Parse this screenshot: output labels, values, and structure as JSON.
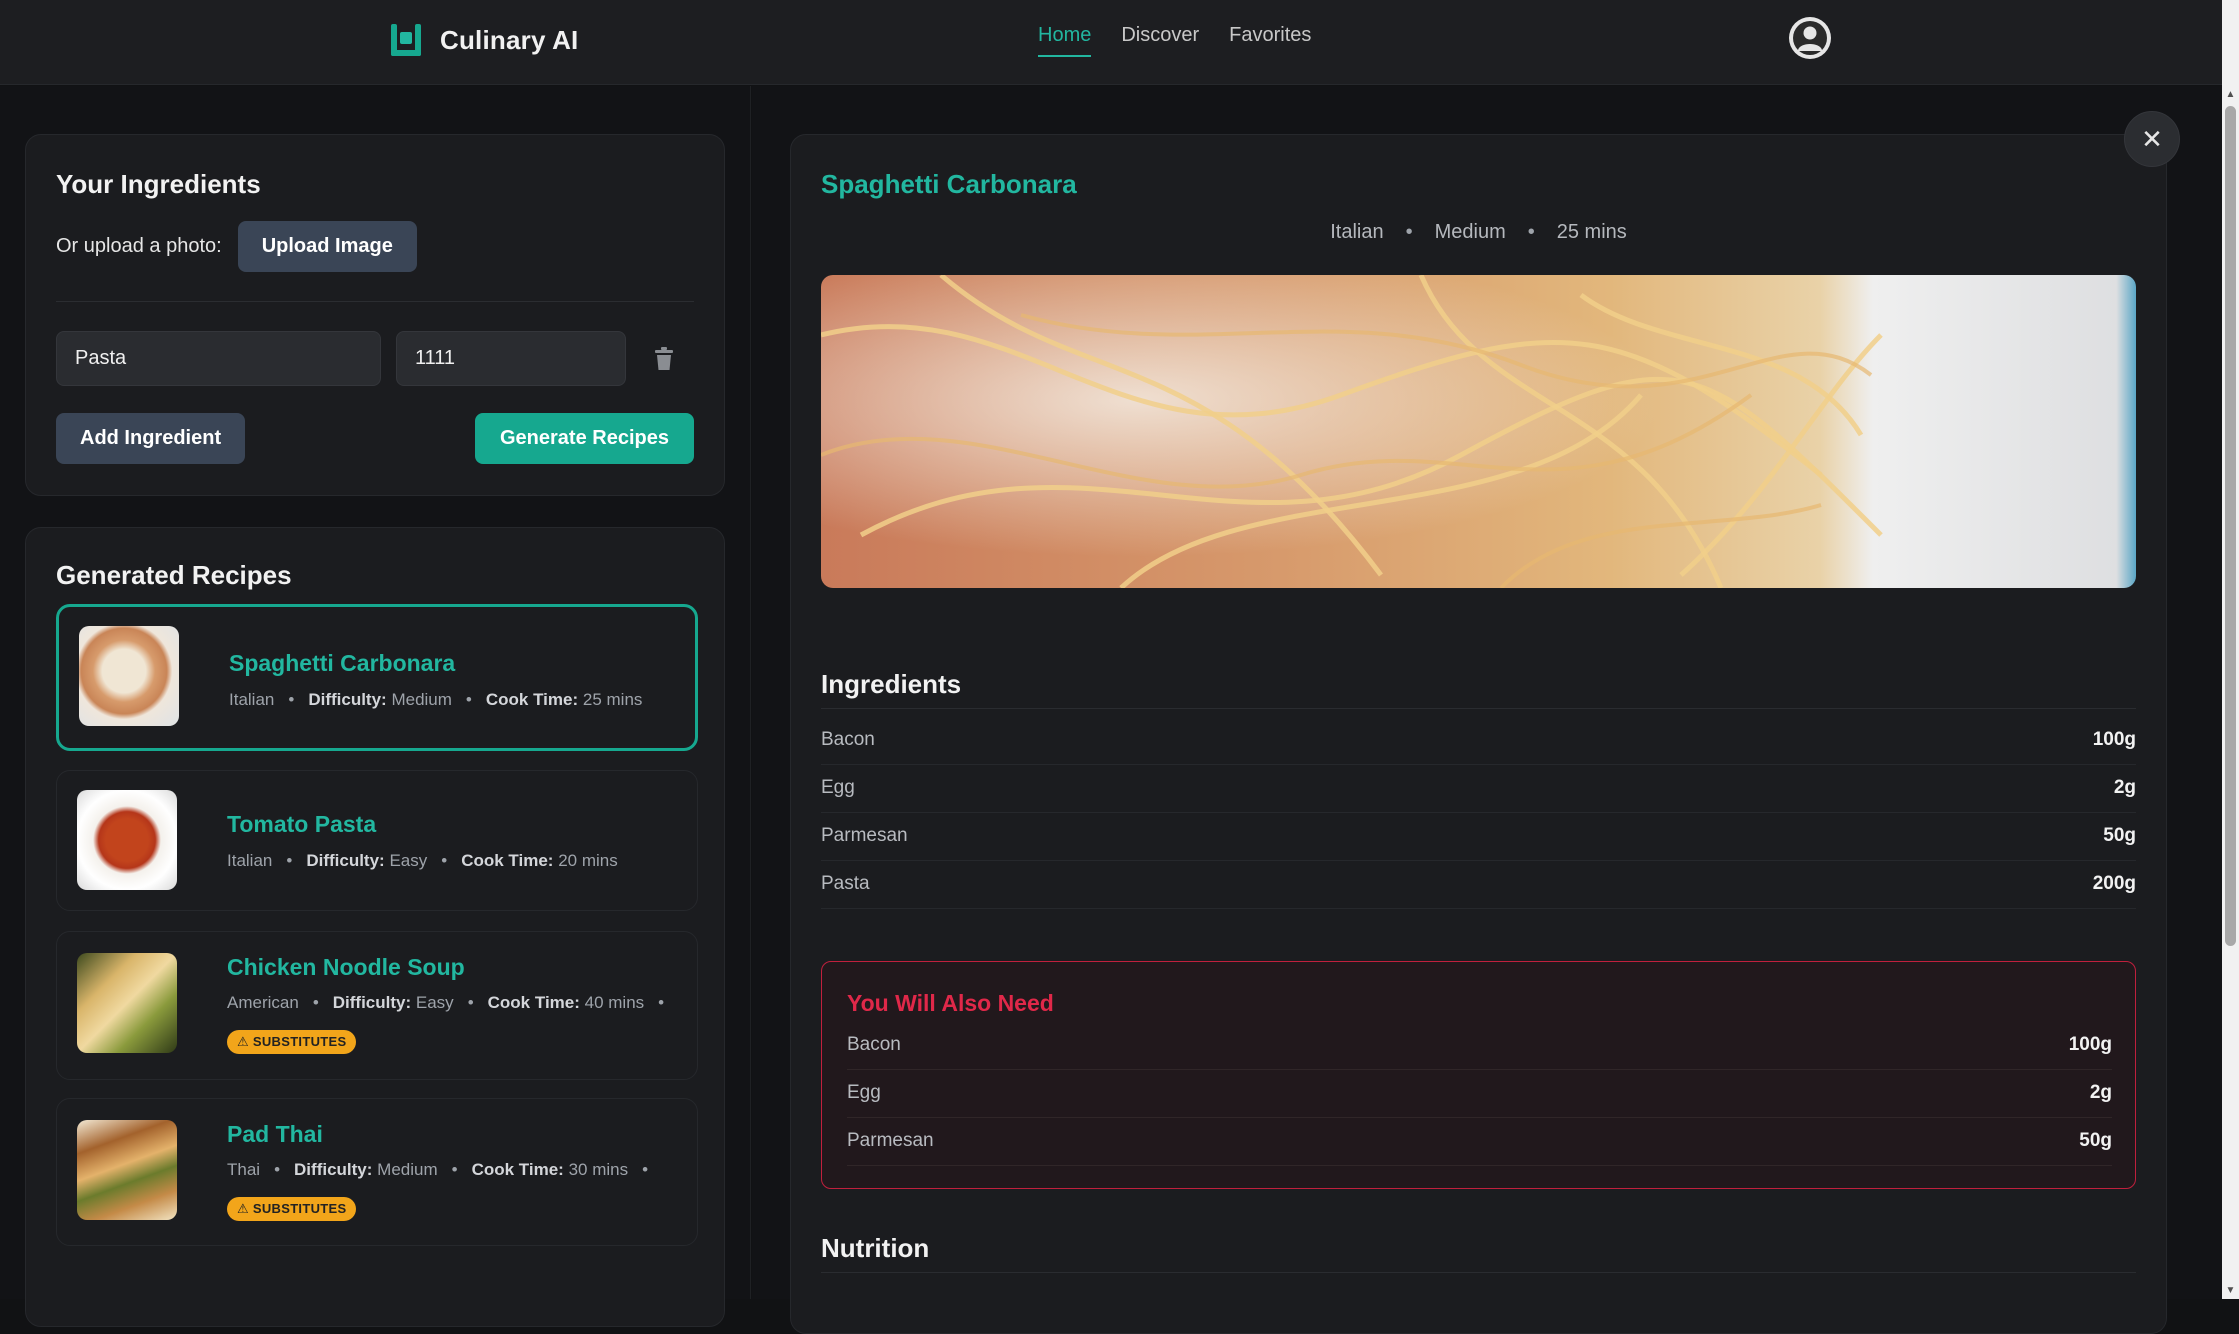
{
  "app": {
    "name": "Culinary AI"
  },
  "nav": {
    "items": [
      {
        "label": "Home",
        "active": true
      },
      {
        "label": "Discover",
        "active": false
      },
      {
        "label": "Favorites",
        "active": false
      }
    ]
  },
  "ingredients_panel": {
    "title": "Your Ingredients",
    "upload_label": "Or upload a photo:",
    "upload_button": "Upload Image",
    "name_value": "Pasta",
    "quantity_value": "1111",
    "add_button": "Add Ingredient",
    "generate_button": "Generate Recipes"
  },
  "recipes_panel": {
    "title": "Generated Recipes",
    "difficulty_label": "Difficulty:",
    "cook_time_label": "Cook Time:",
    "items": [
      {
        "name": "Spaghetti Carbonara",
        "cuisine": "Italian",
        "difficulty": "Medium",
        "cook_time": "25 mins",
        "badge": ""
      },
      {
        "name": "Tomato Pasta",
        "cuisine": "Italian",
        "difficulty": "Easy",
        "cook_time": "20 mins",
        "badge": ""
      },
      {
        "name": "Chicken Noodle Soup",
        "cuisine": "American",
        "difficulty": "Easy",
        "cook_time": "40 mins",
        "badge": "SUBSTITUTES"
      },
      {
        "name": "Pad Thai",
        "cuisine": "Thai",
        "difficulty": "Medium",
        "cook_time": "30 mins",
        "badge": "SUBSTITUTES"
      }
    ]
  },
  "detail": {
    "title": "Spaghetti Carbonara",
    "cuisine": "Italian",
    "difficulty": "Medium",
    "time": "25 mins",
    "ingredients_heading": "Ingredients",
    "ingredients": [
      {
        "name": "Bacon",
        "amount": "100g"
      },
      {
        "name": "Egg",
        "amount": "2g"
      },
      {
        "name": "Parmesan",
        "amount": "50g"
      },
      {
        "name": "Pasta",
        "amount": "200g"
      }
    ],
    "also_need_heading": "You Will Also Need",
    "also_need": [
      {
        "name": "Bacon",
        "amount": "100g"
      },
      {
        "name": "Egg",
        "amount": "2g"
      },
      {
        "name": "Parmesan",
        "amount": "50g"
      }
    ],
    "nutrition_heading": "Nutrition"
  },
  "colors": {
    "accent": "#16a88f",
    "accent_text": "#22b7a0",
    "warning": "#e02849",
    "badge": "#f2a51a"
  },
  "icons": {
    "logo": "chef-hat-logo-icon",
    "close": "close-icon",
    "delete": "trash-icon",
    "user": "user-avatar-icon",
    "substitute": "warning-icon"
  }
}
